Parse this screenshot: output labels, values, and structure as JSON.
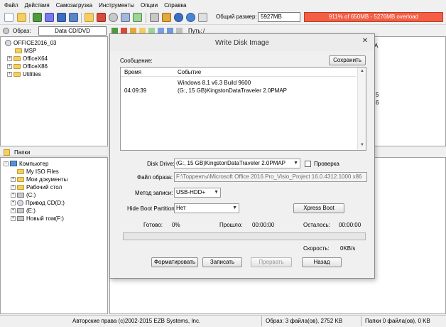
{
  "menu": [
    "Файл",
    "Действия",
    "Самозагрузка",
    "Инструменты",
    "Опции",
    "Справка"
  ],
  "toolbar": {
    "size_label": "Общий размер:",
    "size_value": "5927MB",
    "overload_text": "911% of 650MB - 5276MB overload",
    "overload_color": "#f35e45"
  },
  "image_bar": {
    "image_label": "Образ:",
    "image_type": "Data CD/DVD",
    "path_label": "Путь:",
    "path_value": "/"
  },
  "image_tree": {
    "root": "OFFICE2016_03",
    "children": [
      "MSP",
      "OfficeX64",
      "OfficeX86",
      "Utilities"
    ]
  },
  "right_pane_fragments": [
    "A",
    "5",
    "6"
  ],
  "folders": {
    "title": "Папки",
    "items": [
      {
        "label": "Компьютер",
        "icon": "computer-icon"
      },
      {
        "label": "My ISO Files",
        "icon": "folder-icon"
      },
      {
        "label": "Мои документы",
        "icon": "folder-icon"
      },
      {
        "label": "Рабочий стол",
        "icon": "folder-icon"
      },
      {
        "label": "(C:)",
        "icon": "drive-icon"
      },
      {
        "label": "Привод CD(D:)",
        "icon": "disc-icon"
      },
      {
        "label": "(E:)",
        "icon": "drive-icon"
      },
      {
        "label": "Новый том(F:)",
        "icon": "drive-icon"
      }
    ]
  },
  "status": {
    "copyright": "Авторские права (c)2002-2015 EZB Systems, Inc.",
    "image_info": "Образ: 3 файла(ов), 2752 KB",
    "folder_info": "Папки 0 файла(ов), 0 KB"
  },
  "dialog": {
    "title": "Write Disk Image",
    "close_glyph": "✕",
    "message_label": "Сообщение:",
    "save_button": "Сохранить",
    "log_headers": {
      "time": "Время",
      "event": "Событие"
    },
    "log_rows": [
      {
        "time": "",
        "event": "Windows 8.1 v6.3 Build 9600"
      },
      {
        "time": "04:09:39",
        "event": "(G:, 15 GB)KingstonDataTraveler 2.0PMAP"
      }
    ],
    "disk_drive_label": "Disk Drive:",
    "disk_drive_value": "(G:, 15 GB)KingstonDataTraveler 2.0PMAP",
    "verify_label": "Проверка",
    "image_file_label": "Файл образа:",
    "image_file_value": "F:\\Торренты\\Microsoft Office 2016 Pro_Visio_Project 16.0.4312.1000 x86",
    "write_method_label": "Метод записи:",
    "write_method_value": "USB-HDD+",
    "hide_boot_label": "Hide Boot Partition:",
    "hide_boot_value": "Нет",
    "xpress_boot_button": "Xpress Boot",
    "done_label": "Готово:",
    "done_value": "0%",
    "elapsed_label": "Прошло:",
    "elapsed_value": "00:00:00",
    "remaining_label": "Осталось:",
    "remaining_value": "00:00:00",
    "progress": 0,
    "speed_label": "Скорость:",
    "speed_value": "0KB/s",
    "format_button": "Форматировать",
    "write_button": "Записать",
    "abort_button": "Прервать",
    "back_button": "Назад"
  }
}
